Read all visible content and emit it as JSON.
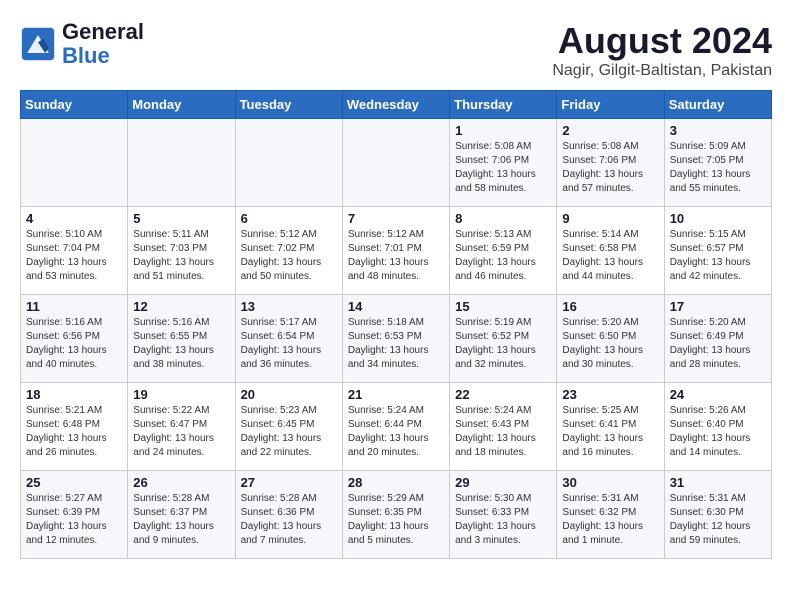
{
  "header": {
    "logo": {
      "line1": "General",
      "line2": "Blue"
    },
    "title": "August 2024",
    "subtitle": "Nagir, Gilgit-Baltistan, Pakistan"
  },
  "weekdays": [
    "Sunday",
    "Monday",
    "Tuesday",
    "Wednesday",
    "Thursday",
    "Friday",
    "Saturday"
  ],
  "weeks": [
    [
      {
        "day": "",
        "info": ""
      },
      {
        "day": "",
        "info": ""
      },
      {
        "day": "",
        "info": ""
      },
      {
        "day": "",
        "info": ""
      },
      {
        "day": "1",
        "info": "Sunrise: 5:08 AM\nSunset: 7:06 PM\nDaylight: 13 hours\nand 58 minutes."
      },
      {
        "day": "2",
        "info": "Sunrise: 5:08 AM\nSunset: 7:06 PM\nDaylight: 13 hours\nand 57 minutes."
      },
      {
        "day": "3",
        "info": "Sunrise: 5:09 AM\nSunset: 7:05 PM\nDaylight: 13 hours\nand 55 minutes."
      }
    ],
    [
      {
        "day": "4",
        "info": "Sunrise: 5:10 AM\nSunset: 7:04 PM\nDaylight: 13 hours\nand 53 minutes."
      },
      {
        "day": "5",
        "info": "Sunrise: 5:11 AM\nSunset: 7:03 PM\nDaylight: 13 hours\nand 51 minutes."
      },
      {
        "day": "6",
        "info": "Sunrise: 5:12 AM\nSunset: 7:02 PM\nDaylight: 13 hours\nand 50 minutes."
      },
      {
        "day": "7",
        "info": "Sunrise: 5:12 AM\nSunset: 7:01 PM\nDaylight: 13 hours\nand 48 minutes."
      },
      {
        "day": "8",
        "info": "Sunrise: 5:13 AM\nSunset: 6:59 PM\nDaylight: 13 hours\nand 46 minutes."
      },
      {
        "day": "9",
        "info": "Sunrise: 5:14 AM\nSunset: 6:58 PM\nDaylight: 13 hours\nand 44 minutes."
      },
      {
        "day": "10",
        "info": "Sunrise: 5:15 AM\nSunset: 6:57 PM\nDaylight: 13 hours\nand 42 minutes."
      }
    ],
    [
      {
        "day": "11",
        "info": "Sunrise: 5:16 AM\nSunset: 6:56 PM\nDaylight: 13 hours\nand 40 minutes."
      },
      {
        "day": "12",
        "info": "Sunrise: 5:16 AM\nSunset: 6:55 PM\nDaylight: 13 hours\nand 38 minutes."
      },
      {
        "day": "13",
        "info": "Sunrise: 5:17 AM\nSunset: 6:54 PM\nDaylight: 13 hours\nand 36 minutes."
      },
      {
        "day": "14",
        "info": "Sunrise: 5:18 AM\nSunset: 6:53 PM\nDaylight: 13 hours\nand 34 minutes."
      },
      {
        "day": "15",
        "info": "Sunrise: 5:19 AM\nSunset: 6:52 PM\nDaylight: 13 hours\nand 32 minutes."
      },
      {
        "day": "16",
        "info": "Sunrise: 5:20 AM\nSunset: 6:50 PM\nDaylight: 13 hours\nand 30 minutes."
      },
      {
        "day": "17",
        "info": "Sunrise: 5:20 AM\nSunset: 6:49 PM\nDaylight: 13 hours\nand 28 minutes."
      }
    ],
    [
      {
        "day": "18",
        "info": "Sunrise: 5:21 AM\nSunset: 6:48 PM\nDaylight: 13 hours\nand 26 minutes."
      },
      {
        "day": "19",
        "info": "Sunrise: 5:22 AM\nSunset: 6:47 PM\nDaylight: 13 hours\nand 24 minutes."
      },
      {
        "day": "20",
        "info": "Sunrise: 5:23 AM\nSunset: 6:45 PM\nDaylight: 13 hours\nand 22 minutes."
      },
      {
        "day": "21",
        "info": "Sunrise: 5:24 AM\nSunset: 6:44 PM\nDaylight: 13 hours\nand 20 minutes."
      },
      {
        "day": "22",
        "info": "Sunrise: 5:24 AM\nSunset: 6:43 PM\nDaylight: 13 hours\nand 18 minutes."
      },
      {
        "day": "23",
        "info": "Sunrise: 5:25 AM\nSunset: 6:41 PM\nDaylight: 13 hours\nand 16 minutes."
      },
      {
        "day": "24",
        "info": "Sunrise: 5:26 AM\nSunset: 6:40 PM\nDaylight: 13 hours\nand 14 minutes."
      }
    ],
    [
      {
        "day": "25",
        "info": "Sunrise: 5:27 AM\nSunset: 6:39 PM\nDaylight: 13 hours\nand 12 minutes."
      },
      {
        "day": "26",
        "info": "Sunrise: 5:28 AM\nSunset: 6:37 PM\nDaylight: 13 hours\nand 9 minutes."
      },
      {
        "day": "27",
        "info": "Sunrise: 5:28 AM\nSunset: 6:36 PM\nDaylight: 13 hours\nand 7 minutes."
      },
      {
        "day": "28",
        "info": "Sunrise: 5:29 AM\nSunset: 6:35 PM\nDaylight: 13 hours\nand 5 minutes."
      },
      {
        "day": "29",
        "info": "Sunrise: 5:30 AM\nSunset: 6:33 PM\nDaylight: 13 hours\nand 3 minutes."
      },
      {
        "day": "30",
        "info": "Sunrise: 5:31 AM\nSunset: 6:32 PM\nDaylight: 13 hours\nand 1 minute."
      },
      {
        "day": "31",
        "info": "Sunrise: 5:31 AM\nSunset: 6:30 PM\nDaylight: 12 hours\nand 59 minutes."
      }
    ]
  ]
}
